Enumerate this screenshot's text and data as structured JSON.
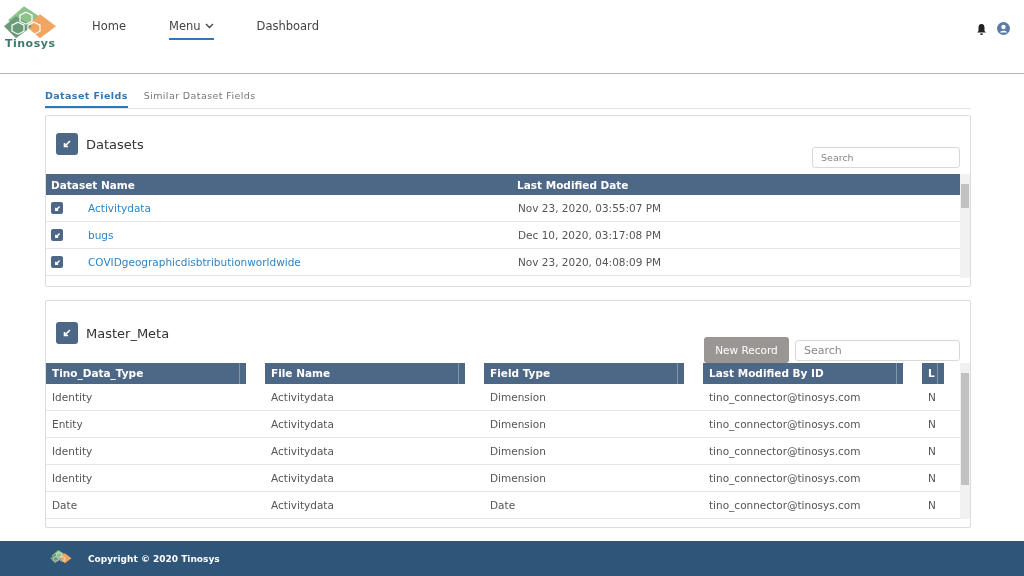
{
  "header": {
    "logo_text": "Tinosys",
    "nav": [
      {
        "label": "Home",
        "selected": false,
        "kind": "link"
      },
      {
        "label": "Menu",
        "selected": true,
        "kind": "dropdown"
      },
      {
        "label": "Dashboard",
        "selected": false,
        "kind": "link"
      }
    ]
  },
  "tabs": [
    {
      "label": "Dataset Fields",
      "selected": true
    },
    {
      "label": "Similar Dataset Fields",
      "selected": false
    }
  ],
  "datasets": {
    "title": "Datasets",
    "search": {
      "placeholder": "Search"
    },
    "columns": [
      "Dataset Name",
      "Last Modified Date"
    ],
    "rows": [
      {
        "name": "Activitydata",
        "date": "Nov 23, 2020, 03:55:07 PM"
      },
      {
        "name": "bugs",
        "date": "Dec 10, 2020, 03:17:08 PM"
      },
      {
        "name": "COVIDgeographicdisbtributionworldwide",
        "date": "Nov 23, 2020, 04:08:09 PM"
      }
    ]
  },
  "master": {
    "title": "Master_Meta",
    "new_record": {
      "label": "New Record",
      "disabled": true
    },
    "search": {
      "placeholder": "Search"
    },
    "columns": [
      "Tino_Data_Type",
      "File Name",
      "Field Type",
      "Last Modified By ID",
      "L"
    ],
    "rows": [
      [
        "Identity",
        "Activitydata",
        "Dimension",
        "tino_connector@tinosys.com",
        "N"
      ],
      [
        "Entity",
        "Activitydata",
        "Dimension",
        "tino_connector@tinosys.com",
        "N"
      ],
      [
        "Identity",
        "Activitydata",
        "Dimension",
        "tino_connector@tinosys.com",
        "N"
      ],
      [
        "Identity",
        "Activitydata",
        "Dimension",
        "tino_connector@tinosys.com",
        "N"
      ],
      [
        "Date",
        "Activitydata",
        "Date",
        "tino_connector@tinosys.com",
        "N"
      ]
    ]
  },
  "footer": {
    "copyright": "Copyright © 2020 Tinosys"
  }
}
